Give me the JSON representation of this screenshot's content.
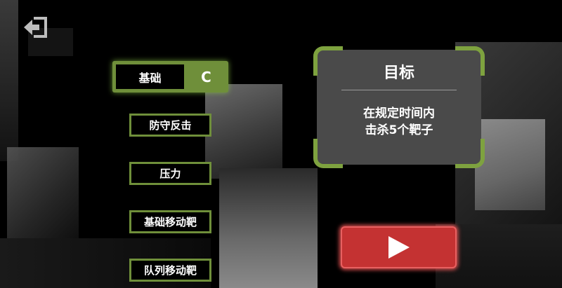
{
  "back": {
    "icon": "back-exit-icon"
  },
  "modes": {
    "selected": {
      "label": "基础",
      "grade": "C"
    },
    "items": [
      {
        "label": "防守反击"
      },
      {
        "label": "压力"
      },
      {
        "label": "基础移动靶"
      },
      {
        "label": "队列移动靶"
      }
    ]
  },
  "goal": {
    "title": "目标",
    "line1": "在规定时间内",
    "line2": "击杀5个靶子"
  },
  "play": {
    "icon": "play-icon"
  },
  "colors": {
    "accent_green": "#6f8f3a",
    "panel_gray": "#4a4a4a",
    "play_red": "#c43232"
  }
}
